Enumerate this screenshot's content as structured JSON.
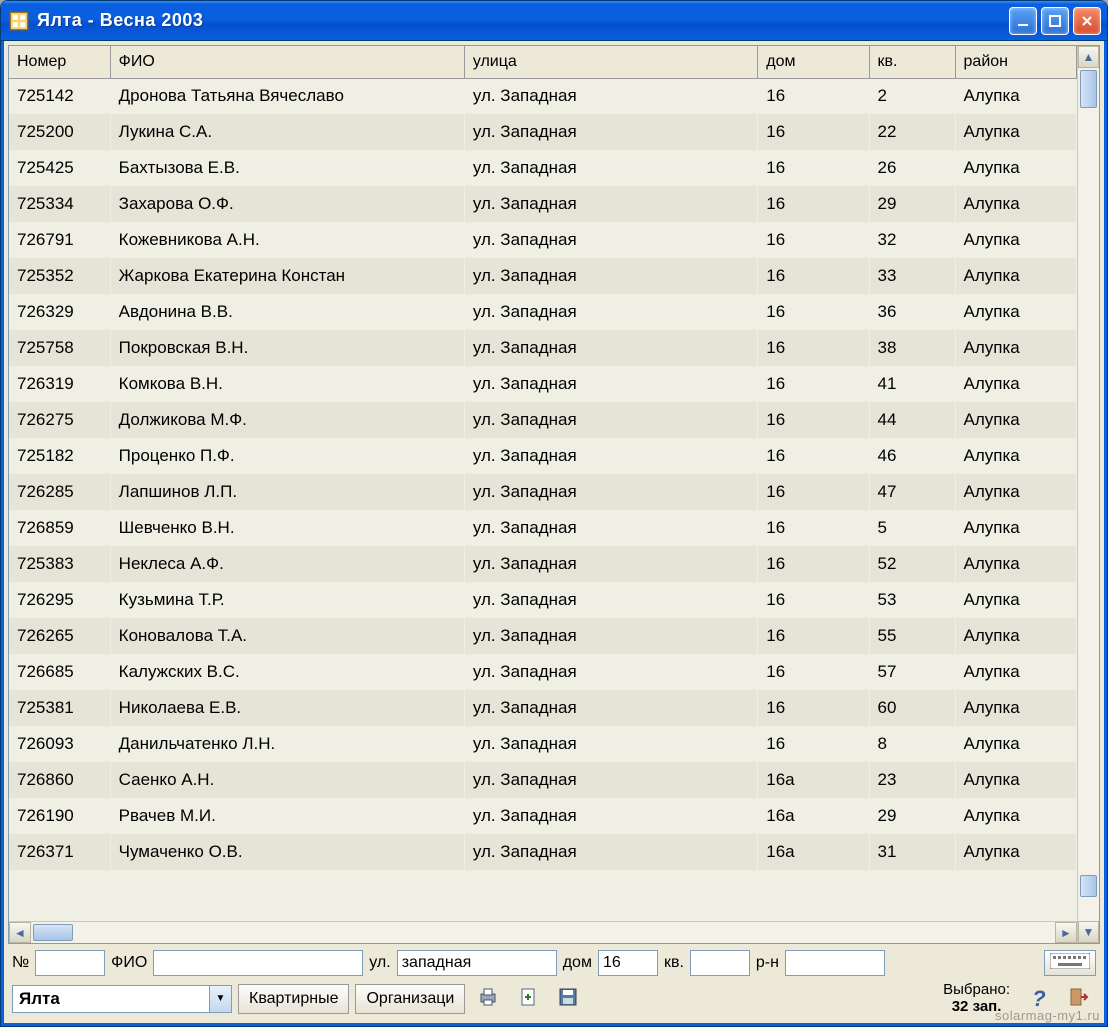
{
  "window": {
    "title": "Ялта  - Весна 2003"
  },
  "table": {
    "headers": {
      "number": "Номер",
      "fio": "ФИО",
      "street": "улица",
      "house": "дом",
      "apt": "кв.",
      "area": "район"
    },
    "rows": [
      {
        "number": "725142",
        "fio": "Дронова Татьяна Вячеславо",
        "street": "ул. Западная",
        "house": "16",
        "apt": "2",
        "area": "Алупка"
      },
      {
        "number": "725200",
        "fio": "Лукина С.А.",
        "street": "ул. Западная",
        "house": "16",
        "apt": "22",
        "area": "Алупка"
      },
      {
        "number": "725425",
        "fio": "Бахтызова Е.В.",
        "street": "ул. Западная",
        "house": "16",
        "apt": "26",
        "area": "Алупка"
      },
      {
        "number": "725334",
        "fio": "Захарова О.Ф.",
        "street": "ул. Западная",
        "house": "16",
        "apt": "29",
        "area": "Алупка"
      },
      {
        "number": "726791",
        "fio": "Кожевникова А.Н.",
        "street": "ул. Западная",
        "house": "16",
        "apt": "32",
        "area": "Алупка"
      },
      {
        "number": "725352",
        "fio": "Жаркова Екатерина Констан",
        "street": "ул. Западная",
        "house": "16",
        "apt": "33",
        "area": "Алупка"
      },
      {
        "number": "726329",
        "fio": "Авдонина В.В.",
        "street": "ул. Западная",
        "house": "16",
        "apt": "36",
        "area": "Алупка"
      },
      {
        "number": "725758",
        "fio": "Покровская В.Н.",
        "street": "ул. Западная",
        "house": "16",
        "apt": "38",
        "area": "Алупка"
      },
      {
        "number": "726319",
        "fio": "Комкова В.Н.",
        "street": "ул. Западная",
        "house": "16",
        "apt": "41",
        "area": "Алупка"
      },
      {
        "number": "726275",
        "fio": "Должикова М.Ф.",
        "street": "ул. Западная",
        "house": "16",
        "apt": "44",
        "area": "Алупка"
      },
      {
        "number": "725182",
        "fio": "Проценко П.Ф.",
        "street": "ул. Западная",
        "house": "16",
        "apt": "46",
        "area": "Алупка"
      },
      {
        "number": "726285",
        "fio": "Лапшинов Л.П.",
        "street": "ул. Западная",
        "house": "16",
        "apt": "47",
        "area": "Алупка"
      },
      {
        "number": "726859",
        "fio": "Шевченко В.Н.",
        "street": "ул. Западная",
        "house": "16",
        "apt": "5",
        "area": "Алупка"
      },
      {
        "number": "725383",
        "fio": "Неклеса А.Ф.",
        "street": "ул. Западная",
        "house": "16",
        "apt": "52",
        "area": "Алупка"
      },
      {
        "number": "726295",
        "fio": "Кузьмина Т.Р.",
        "street": "ул. Западная",
        "house": "16",
        "apt": "53",
        "area": "Алупка"
      },
      {
        "number": "726265",
        "fio": "Коновалова Т.А.",
        "street": "ул. Западная",
        "house": "16",
        "apt": "55",
        "area": "Алупка"
      },
      {
        "number": "726685",
        "fio": "Калужских В.С.",
        "street": "ул. Западная",
        "house": "16",
        "apt": "57",
        "area": "Алупка"
      },
      {
        "number": "725381",
        "fio": "Николаева Е.В.",
        "street": "ул. Западная",
        "house": "16",
        "apt": "60",
        "area": "Алупка"
      },
      {
        "number": "726093",
        "fio": "Данильчатенко Л.Н.",
        "street": "ул. Западная",
        "house": "16",
        "apt": "8",
        "area": "Алупка"
      },
      {
        "number": "726860",
        "fio": "Саенко А.Н.",
        "street": "ул. Западная",
        "house": "16а",
        "apt": "23",
        "area": "Алупка"
      },
      {
        "number": "726190",
        "fio": "Рвачев М.И.",
        "street": "ул. Западная",
        "house": "16а",
        "apt": "29",
        "area": "Алупка"
      },
      {
        "number": "726371",
        "fio": "Чумаченко О.В.",
        "street": "ул. Западная",
        "house": "16а",
        "apt": "31",
        "area": "Алупка"
      }
    ]
  },
  "filters": {
    "number_label": "№",
    "number_value": "",
    "fio_label": "ФИО",
    "fio_value": "",
    "street_label": "ул.",
    "street_value": "западная",
    "house_label": "дом",
    "house_value": "16",
    "apt_label": "кв.",
    "apt_value": "",
    "area_label": "р-н",
    "area_value": ""
  },
  "toolbar": {
    "combo_value": "Ялта",
    "btn_apartments": "Квартирные",
    "btn_organizations": "Организаци",
    "status_label": "Выбрано:",
    "status_count": "32 зап."
  },
  "watermark": "solarmag-my1.ru"
}
